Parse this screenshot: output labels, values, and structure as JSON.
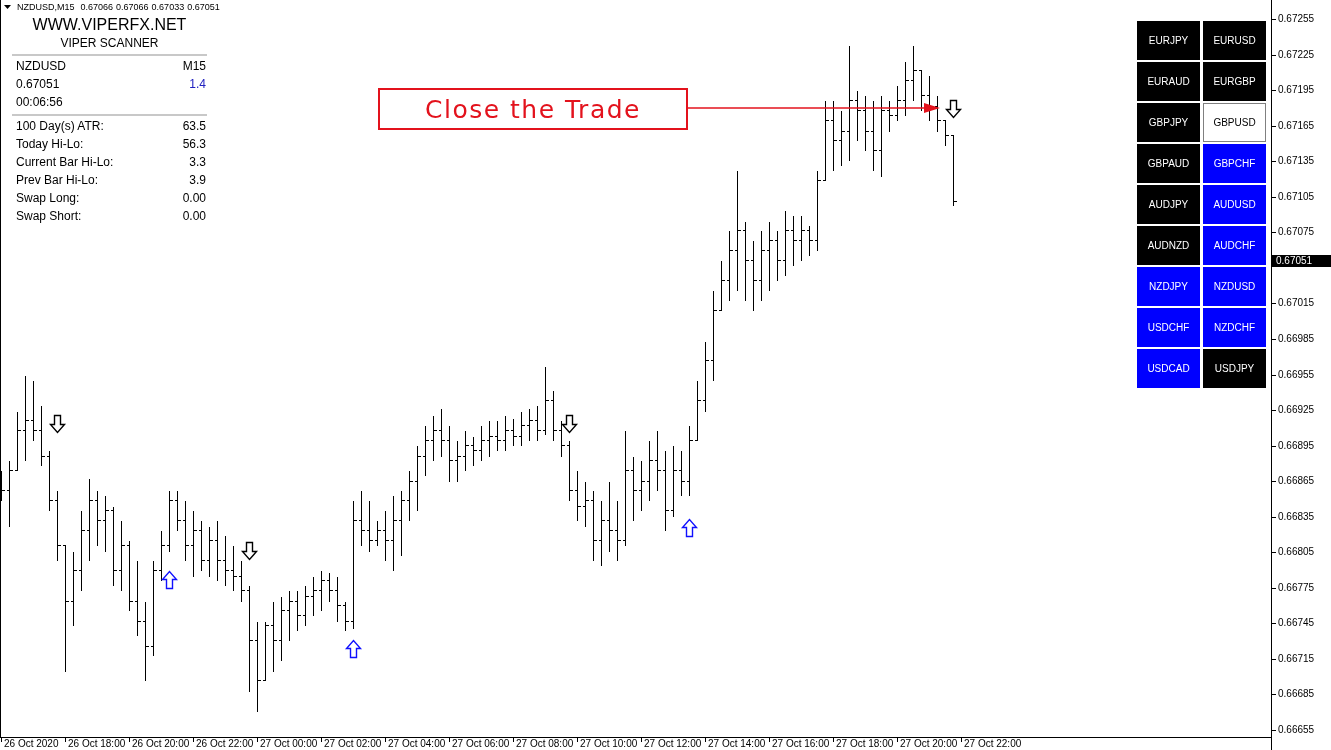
{
  "chart_header": {
    "symbol": "NZDUSD,M15",
    "prices": [
      "0.67066",
      "0.67066",
      "0.67033",
      "0.67051"
    ]
  },
  "scanner_panel": {
    "site": "WWW.VIPERFX.NET",
    "title": "VIPER SCANNER",
    "symbol": "NZDUSD",
    "timeframe": "M15",
    "price": "0.67051",
    "spread": "1.4",
    "countdown": "00:06:56",
    "stats": [
      {
        "label": "100 Day(s) ATR:",
        "value": "63.5"
      },
      {
        "label": "Today Hi-Lo:",
        "value": "56.3"
      },
      {
        "label": "Current Bar Hi-Lo:",
        "value": "3.3"
      },
      {
        "label": "Prev Bar Hi-Lo:",
        "value": "3.9"
      },
      {
        "label": "Swap Long:",
        "value": "0.00"
      },
      {
        "label": "Swap Short:",
        "value": "0.00"
      }
    ]
  },
  "callout": {
    "text": "Close the Trade"
  },
  "pair_buttons": [
    {
      "label": "EURJPY",
      "color": "#000000"
    },
    {
      "label": "EURUSD",
      "color": "#000000"
    },
    {
      "label": "EURAUD",
      "color": "#000000"
    },
    {
      "label": "EURGBP",
      "color": "#000000"
    },
    {
      "label": "GBPJPY",
      "color": "#000000"
    },
    {
      "label": "GBPUSD",
      "color": "#ffffff"
    },
    {
      "label": "GBPAUD",
      "color": "#000000"
    },
    {
      "label": "GBPCHF",
      "color": "#0000ff"
    },
    {
      "label": "AUDJPY",
      "color": "#000000"
    },
    {
      "label": "AUDUSD",
      "color": "#0000ff"
    },
    {
      "label": "AUDNZD",
      "color": "#000000"
    },
    {
      "label": "AUDCHF",
      "color": "#0000ff"
    },
    {
      "label": "NZDJPY",
      "color": "#0000ff"
    },
    {
      "label": "NZDUSD",
      "color": "#0000ff"
    },
    {
      "label": "USDCHF",
      "color": "#0000ff"
    },
    {
      "label": "NZDCHF",
      "color": "#0000ff"
    },
    {
      "label": "USDCAD",
      "color": "#0000ff"
    },
    {
      "label": "USDJPY",
      "color": "#000000"
    }
  ],
  "price_axis": {
    "labels": [
      "0.67255",
      "0.67225",
      "0.67195",
      "0.67165",
      "0.67135",
      "0.67105",
      "0.67075",
      "0.67015",
      "0.66985",
      "0.66955",
      "0.66925",
      "0.66895",
      "0.66865",
      "0.66835",
      "0.66805",
      "0.66775",
      "0.66745",
      "0.66715",
      "0.66685",
      "0.66655"
    ],
    "current_price": "0.67051"
  },
  "time_axis": {
    "labels": [
      "26 Oct 2020",
      "26 Oct 18:00",
      "26 Oct 20:00",
      "26 Oct 22:00",
      "27 Oct 00:00",
      "27 Oct 02:00",
      "27 Oct 04:00",
      "27 Oct 06:00",
      "27 Oct 08:00",
      "27 Oct 10:00",
      "27 Oct 12:00",
      "27 Oct 14:00",
      "27 Oct 16:00",
      "27 Oct 18:00",
      "27 Oct 20:00",
      "27 Oct 22:00"
    ]
  }
}
